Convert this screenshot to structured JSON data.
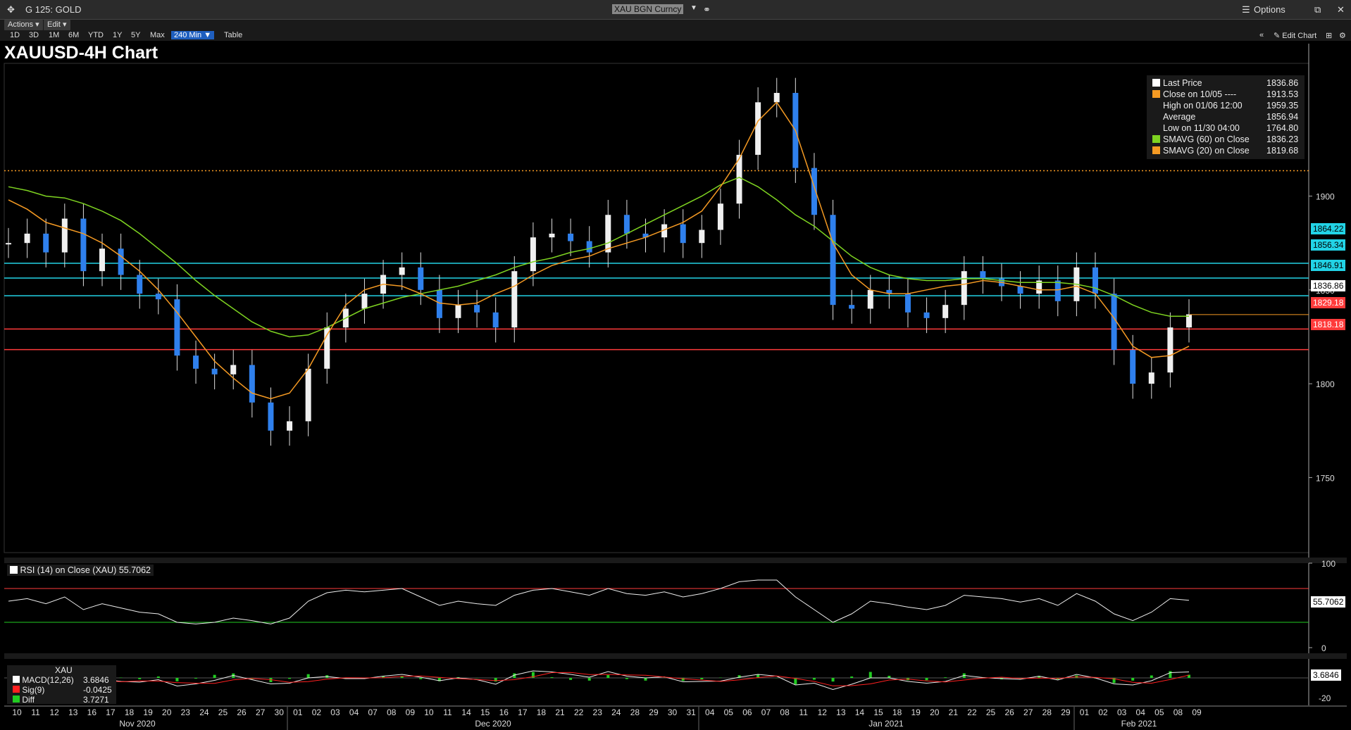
{
  "window": {
    "ticker": "G 125: GOLD",
    "security": "XAU BGN Curncy",
    "options_label": "Options",
    "actions_label": "Actions",
    "edit_label": "Edit",
    "ranges": [
      "1D",
      "3D",
      "1M",
      "6M",
      "YTD",
      "1Y",
      "5Y",
      "Max"
    ],
    "active_range": "240 Min",
    "table_label": "Table",
    "edit_chart_label": "Edit Chart",
    "chart_title": "XAUUSD-4H Chart"
  },
  "legend": [
    {
      "label": "Last Price",
      "value": "1836.86",
      "color": "#ffffff"
    },
    {
      "label": "Close on 10/05 ----",
      "value": "1913.53",
      "color": "#f59a23"
    },
    {
      "label": "High on 01/06 12:00",
      "value": "1959.35",
      "color": "none"
    },
    {
      "label": "Average",
      "value": "1856.94",
      "color": "none"
    },
    {
      "label": "Low on 11/30 04:00",
      "value": "1764.80",
      "color": "none"
    },
    {
      "label": "SMAVG (60)  on Close",
      "value": "1836.23",
      "color": "#7ed321"
    },
    {
      "label": "SMAVG (20)  on Close",
      "value": "1819.68",
      "color": "#f59a23"
    }
  ],
  "price_labels": [
    {
      "value": "1864.22",
      "color": "#22d3e6"
    },
    {
      "value": "1856.34",
      "color": "#22d3e6"
    },
    {
      "value": "1846.91",
      "color": "#22d3e6"
    },
    {
      "value": "1836.86",
      "color": "#ffffff"
    },
    {
      "value": "1829.18",
      "color": "#ff3b3b"
    },
    {
      "value": "1818.18",
      "color": "#ff3b3b"
    }
  ],
  "rsi": {
    "label": "RSI (14)  on Close (XAU)",
    "value": "55.7062",
    "axis": [
      "100",
      "0"
    ]
  },
  "macd": {
    "header": "XAU",
    "rows": [
      {
        "label": "MACD(12,26)",
        "value": "3.6846",
        "color": "#ffffff"
      },
      {
        "label": "Sig(9)",
        "value": "-0.0425",
        "color": "#ff2020"
      },
      {
        "label": "Diff",
        "value": "3.7271",
        "color": "#22cc22"
      }
    ],
    "last": "3.6846",
    "axis": "-20"
  },
  "chart_data": {
    "type": "line",
    "title": "XAUUSD-4H Chart",
    "y_ticks": [
      1900,
      1850,
      1800,
      1750
    ],
    "ylim": [
      1710,
      1970
    ],
    "x_day_labels": [
      "10",
      "11",
      "12",
      "13",
      "16",
      "17",
      "18",
      "19",
      "20",
      "23",
      "24",
      "25",
      "26",
      "27",
      "30",
      "01",
      "02",
      "03",
      "04",
      "07",
      "08",
      "09",
      "10",
      "11",
      "14",
      "15",
      "16",
      "17",
      "18",
      "21",
      "22",
      "23",
      "24",
      "28",
      "29",
      "30",
      "31",
      "04",
      "05",
      "06",
      "07",
      "08",
      "11",
      "12",
      "13",
      "14",
      "15",
      "18",
      "19",
      "20",
      "21",
      "22",
      "25",
      "26",
      "27",
      "28",
      "29",
      "01",
      "02",
      "03",
      "04",
      "05",
      "08",
      "09"
    ],
    "x_month_labels": [
      "Nov 2020",
      "Dec 2020",
      "Jan 2021",
      "Feb 2021"
    ],
    "close_approx": [
      1875,
      1880,
      1870,
      1888,
      1860,
      1872,
      1858,
      1848,
      1845,
      1815,
      1808,
      1805,
      1810,
      1790,
      1775,
      1780,
      1808,
      1830,
      1840,
      1848,
      1858,
      1862,
      1850,
      1835,
      1842,
      1838,
      1830,
      1860,
      1878,
      1880,
      1876,
      1870,
      1890,
      1880,
      1878,
      1885,
      1875,
      1882,
      1896,
      1922,
      1950,
      1955,
      1915,
      1890,
      1842,
      1840,
      1850,
      1848,
      1838,
      1835,
      1842,
      1860,
      1856,
      1852,
      1848,
      1855,
      1844,
      1862,
      1848,
      1818,
      1800,
      1806,
      1830,
      1837
    ],
    "sma20_approx": [
      1898,
      1893,
      1886,
      1883,
      1880,
      1875,
      1868,
      1860,
      1850,
      1838,
      1825,
      1812,
      1803,
      1795,
      1792,
      1795,
      1808,
      1826,
      1842,
      1850,
      1853,
      1852,
      1848,
      1843,
      1842,
      1843,
      1848,
      1852,
      1858,
      1863,
      1866,
      1868,
      1872,
      1875,
      1878,
      1882,
      1886,
      1892,
      1905,
      1920,
      1940,
      1950,
      1935,
      1905,
      1875,
      1858,
      1850,
      1848,
      1848,
      1850,
      1852,
      1853,
      1855,
      1854,
      1852,
      1850,
      1850,
      1852,
      1848,
      1835,
      1820,
      1814,
      1815,
      1820
    ],
    "sma60_approx": [
      1905,
      1903,
      1900,
      1899,
      1896,
      1892,
      1887,
      1880,
      1872,
      1864,
      1855,
      1847,
      1840,
      1833,
      1828,
      1825,
      1826,
      1830,
      1835,
      1840,
      1843,
      1846,
      1848,
      1850,
      1852,
      1855,
      1858,
      1862,
      1865,
      1867,
      1870,
      1872,
      1875,
      1880,
      1885,
      1890,
      1895,
      1900,
      1906,
      1910,
      1905,
      1898,
      1890,
      1884,
      1876,
      1868,
      1862,
      1858,
      1856,
      1855,
      1855,
      1856,
      1856,
      1855,
      1854,
      1854,
      1854,
      1853,
      1851,
      1847,
      1842,
      1838,
      1836,
      1836
    ],
    "h_lines": [
      {
        "y": 1864.22,
        "color": "cyan"
      },
      {
        "y": 1856.34,
        "color": "cyan"
      },
      {
        "y": 1846.91,
        "color": "cyan"
      },
      {
        "y": 1829.18,
        "color": "red"
      },
      {
        "y": 1818.18,
        "color": "red"
      },
      {
        "y": 1913.53,
        "color": "orange",
        "style": "dotted"
      }
    ],
    "rsi_levels": [
      70,
      30
    ],
    "rsi_approx": [
      55,
      58,
      52,
      60,
      45,
      52,
      47,
      42,
      40,
      30,
      28,
      30,
      35,
      32,
      28,
      35,
      55,
      65,
      68,
      66,
      68,
      70,
      60,
      50,
      55,
      52,
      50,
      62,
      68,
      70,
      66,
      62,
      70,
      64,
      62,
      66,
      60,
      64,
      70,
      78,
      80,
      80,
      60,
      45,
      30,
      40,
      55,
      52,
      48,
      45,
      50,
      62,
      60,
      58,
      54,
      58,
      50,
      64,
      55,
      40,
      32,
      42,
      58,
      56
    ]
  }
}
